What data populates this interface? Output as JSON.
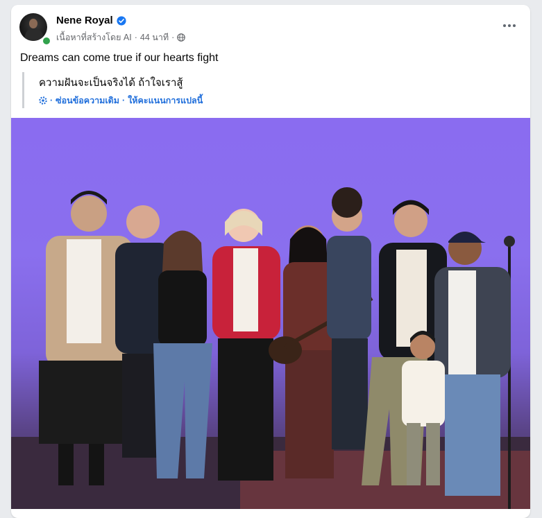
{
  "post": {
    "author_name": "Nene Royal",
    "meta_label": "เนื้อหาที่สร้างโดย AI",
    "time": "44 นาที",
    "separator": "·",
    "text": "Dreams can come true if our hearts fight",
    "translation": {
      "text": "ความฝันจะเป็นจริงได้ ถ้าใจเราสู้",
      "hide_original": "ซ่อนข้อความเดิม",
      "rate_translation": "ให้คะแนนการแปลนี้"
    }
  },
  "colors": {
    "link_blue": "#216fdb",
    "verified_blue": "#1877f2",
    "online_green": "#31a24c",
    "stage_purple": "#8a6cf0"
  },
  "icons": [
    "verified-badge-icon",
    "globe-icon",
    "more-options-icon",
    "translate-settings-icon"
  ]
}
